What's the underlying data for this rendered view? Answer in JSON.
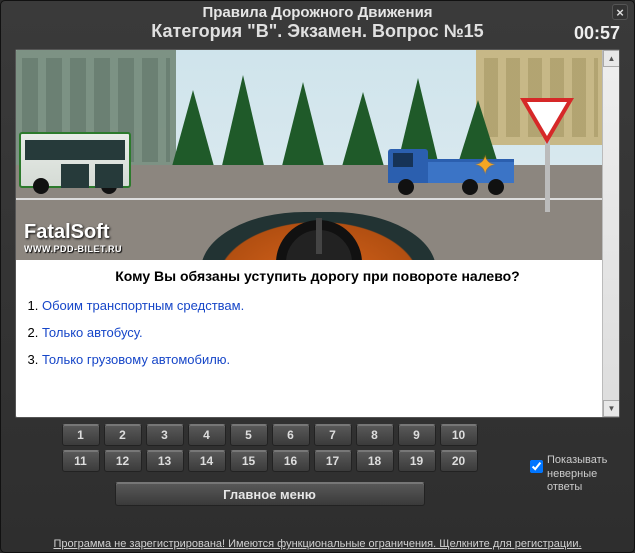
{
  "header": {
    "title1": "Правила Дорожного Движения",
    "title2": "Категория \"B\". Экзамен. Вопрос №15"
  },
  "timer": "00:57",
  "watermark": {
    "brand": "FatalSoft",
    "url": "WWW.PDD-BILET.RU"
  },
  "question": "Кому Вы обязаны уступить дорогу при повороте налево?",
  "answers": [
    "Обоим транспортным средствам.",
    "Только автобусу.",
    "Только грузовому автомобилю."
  ],
  "nav_numbers": [
    "1",
    "2",
    "3",
    "4",
    "5",
    "6",
    "7",
    "8",
    "9",
    "10",
    "11",
    "12",
    "13",
    "14",
    "15",
    "16",
    "17",
    "18",
    "19",
    "20"
  ],
  "main_menu": "Главное меню",
  "checkbox_label": "Показывать неверные ответы",
  "footer": "Программа не зарегистрирована! Имеются функциональные ограничения. Щелкните для регистрации.",
  "close": "×"
}
